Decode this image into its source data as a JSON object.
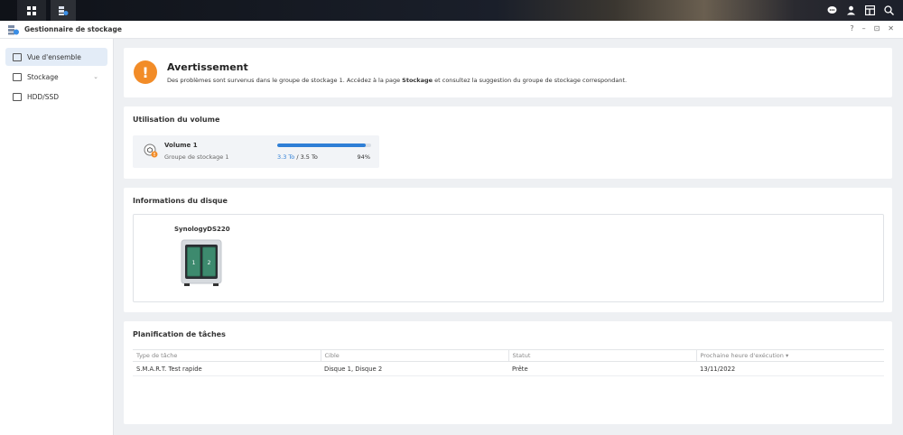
{
  "taskbar": {
    "left_icons": [
      "grid-icon",
      "storage-manager-icon"
    ],
    "right_icons": [
      "chat-icon",
      "user-icon",
      "widgets-icon",
      "search-icon"
    ]
  },
  "window": {
    "title": "Gestionnaire de stockage",
    "controls": [
      "?",
      "–",
      "⊡",
      "✕"
    ]
  },
  "sidebar": {
    "items": [
      {
        "label": "Vue d'ensemble",
        "active": true
      },
      {
        "label": "Stockage",
        "active": false
      },
      {
        "label": "HDD/SSD",
        "active": false
      }
    ]
  },
  "warning": {
    "title": "Avertissement",
    "message_pre": "Des problèmes sont survenus dans le groupe de stockage 1. Accédez à la page ",
    "message_bold": "Stockage",
    "message_post": " et consultez la suggestion du groupe de stockage correspondant."
  },
  "volume_usage": {
    "title": "Utilisation du volume",
    "volume_name": "Volume 1",
    "pool": "Groupe de stockage 1",
    "used": "3.3 To",
    "separator": " / ",
    "total": "3.5 To",
    "percent_label": "94%",
    "percent": 94
  },
  "disk_info": {
    "title": "Informations du disque",
    "nas_name": "SynologyDS220",
    "bays": [
      "1",
      "2"
    ]
  },
  "tasks": {
    "title": "Planification de tâches",
    "columns": [
      "Type de tâche",
      "Cible",
      "Statut",
      "Prochaine heure d'exécution ▾"
    ],
    "rows": [
      [
        "S.M.A.R.T. Test rapide",
        "Disque 1, Disque 2",
        "Prête",
        "13/11/2022"
      ]
    ]
  },
  "colors": {
    "accent": "#2f7fd6",
    "warning": "#f28c28"
  }
}
